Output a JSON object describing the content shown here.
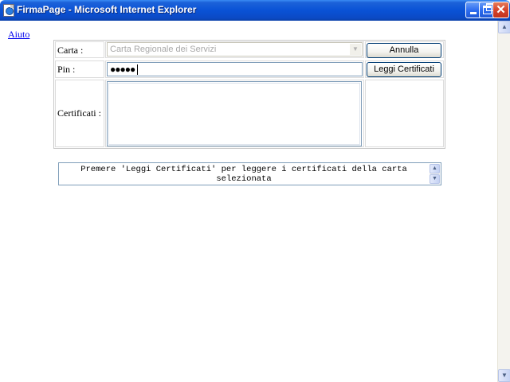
{
  "window": {
    "title": "FirmaPage - Microsoft Internet Explorer",
    "minimize_glyph": "",
    "close_glyph": "✕"
  },
  "page": {
    "help_link": "Aiuto",
    "form": {
      "card_label": "Carta :",
      "card_selected": "Carta Regionale dei Servizi",
      "pin_label": "Pin :",
      "pin_value": "●●●●●",
      "certificates_label": "Certificati :",
      "cancel_button": "Annulla",
      "read_certificates_button": "Leggi Certificati"
    },
    "message": "Premere 'Leggi Certificati' per leggere i certificati della carta selezionata"
  },
  "icons": {
    "app": "ie-page-icon",
    "select_arrow": "chevron-down-icon",
    "scroll_up": "arrow-up-icon",
    "scroll_down": "arrow-down-icon"
  }
}
